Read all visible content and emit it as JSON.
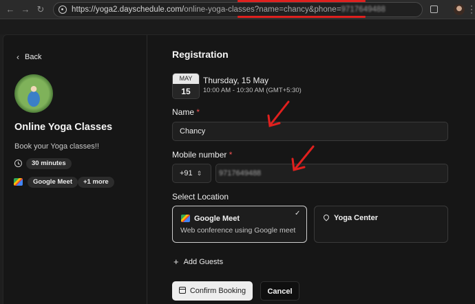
{
  "browser": {
    "url_base": "https://yoga2.dayschedule.com/",
    "url_path": "online-yoga-classes?name=chancy&phone=",
    "url_phone": "9717649488",
    "back_icon": "arrow-left-icon",
    "forward_icon": "arrow-right-icon"
  },
  "sidebar": {
    "back_label": "Back",
    "event_title": "Online Yoga Classes",
    "event_description": "Book your Yoga classes!!",
    "duration": "30 minutes",
    "location_chip": "Google Meet",
    "more_chip": "+1 more"
  },
  "main": {
    "title": "Registration",
    "calendar": {
      "month": "MAY",
      "day": "15"
    },
    "date": "Thursday, 15 May",
    "time": "10:00 AM - 10:30 AM (GMT+5:30)",
    "name_field": {
      "label": "Name",
      "required_mark": "*",
      "value": "Chancy"
    },
    "mobile_field": {
      "label": "Mobile number",
      "required_mark": "*",
      "country_code": "+91",
      "value": "9717649488"
    },
    "location": {
      "label": "Select Location",
      "options": [
        {
          "title": "Google Meet",
          "subtitle": "Web conference using Google meet",
          "selected": true
        },
        {
          "title": "Yoga Center",
          "subtitle": "",
          "selected": false
        }
      ]
    },
    "add_guests_label": "Add Guests",
    "confirm_label": "Confirm Booking",
    "cancel_label": "Cancel"
  },
  "colors": {
    "annotation": "#e0201e",
    "background": "#161616",
    "required": "#f05252"
  }
}
